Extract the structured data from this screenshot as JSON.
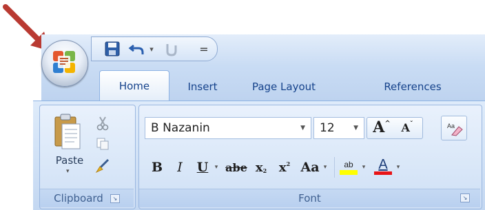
{
  "quick_access": {
    "icons": [
      "save-icon",
      "undo-icon",
      "redo-icon",
      "customize-qat-icon"
    ],
    "undo_dropdown": "▾",
    "redo_dropdown": "▾",
    "customize": "="
  },
  "tabs": [
    {
      "label": "Home",
      "selected": true
    },
    {
      "label": "Insert",
      "selected": false
    },
    {
      "label": "Page Layout",
      "selected": false
    },
    {
      "label": "References",
      "selected": false
    }
  ],
  "clipboard": {
    "paste_label": "Paste",
    "group_label": "Clipboard"
  },
  "font": {
    "group_label": "Font",
    "font_name": "B Nazanin",
    "font_size": "12",
    "grow_label": "A",
    "shrink_label": "A",
    "bold": "B",
    "italic": "I",
    "underline": "U",
    "strike": "abe",
    "subscript": "x",
    "superscript": "x",
    "change_case": "Aa",
    "highlight_label": "ab",
    "font_color_label": "A"
  },
  "colors": {
    "accent_text": "#15428b",
    "highlight": "#ffff00",
    "font_color": "#e81416",
    "pointer": "#c0392b"
  }
}
